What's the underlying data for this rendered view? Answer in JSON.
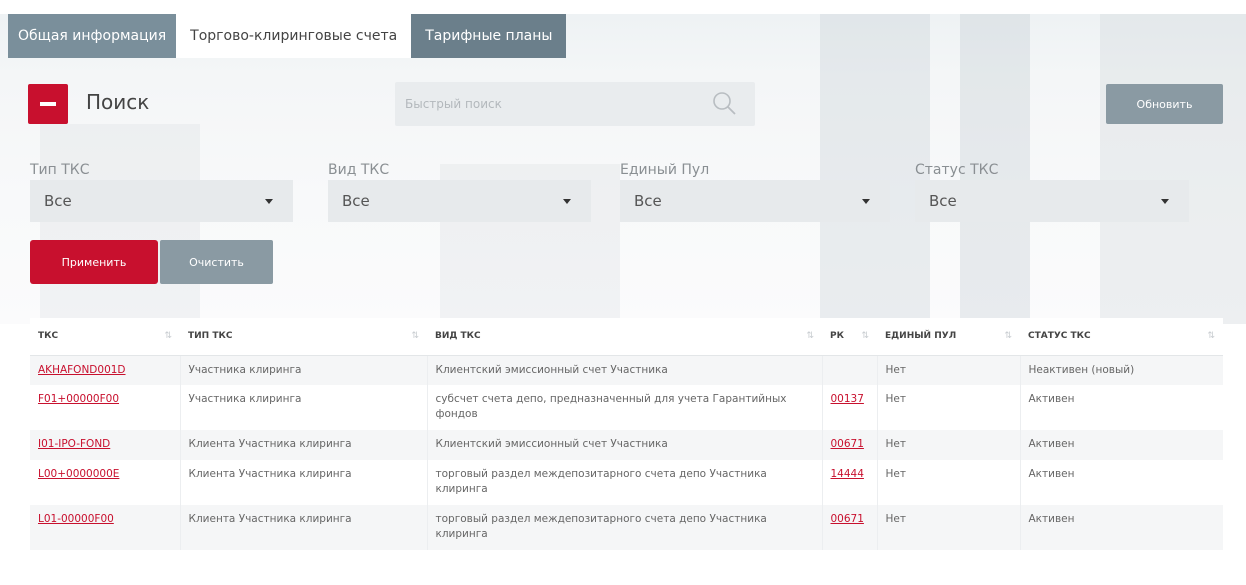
{
  "colors": {
    "accent": "#c8102e",
    "secondary": "#8a9aa3"
  },
  "tabs": [
    {
      "label": "Общая информация"
    },
    {
      "label": "Торгово-клиринговые счета"
    },
    {
      "label": "Тарифные планы"
    }
  ],
  "search": {
    "title": "Поиск",
    "quick_placeholder": "Быстрый поиск",
    "refresh_label": "Обновить"
  },
  "filters": [
    {
      "label": "Тип ТКС",
      "value": "Все"
    },
    {
      "label": "Вид ТКС",
      "value": "Все"
    },
    {
      "label": "Единый Пул",
      "value": "Все"
    },
    {
      "label": "Статус ТКС",
      "value": "Все"
    }
  ],
  "buttons": {
    "apply": "Применить",
    "clear": "Очистить"
  },
  "table": {
    "headers": [
      "ТКС",
      "ТИП ТКС",
      "ВИД ТКС",
      "РК",
      "ЕДИНЫЙ ПУЛ",
      "СТАТУС ТКС"
    ],
    "rows": [
      [
        "AKHAFOND001D",
        "Участника клиринга",
        "Клиентский эмиссионный счет Участника",
        "",
        "Нет",
        "Неактивен (новый)"
      ],
      [
        "F01+00000F00",
        "Участника клиринга",
        "субсчет счета депо, предназначенный для учета Гарантийных фондов",
        "00137",
        "Нет",
        "Активен"
      ],
      [
        "I01-IPO-FOND",
        "Клиента Участника клиринга",
        "Клиентский эмиссионный счет Участника",
        "00671",
        "Нет",
        "Активен"
      ],
      [
        "L00+0000000E",
        "Клиента Участника клиринга",
        "торговый раздел междепозитарного счета депо Участника клиринга",
        "14444",
        "Нет",
        "Активен"
      ],
      [
        "L01-00000F00",
        "Клиента Участника клиринга",
        "торговый раздел междепозитарного счета депо Участника клиринга",
        "00671",
        "Нет",
        "Активен"
      ]
    ]
  }
}
